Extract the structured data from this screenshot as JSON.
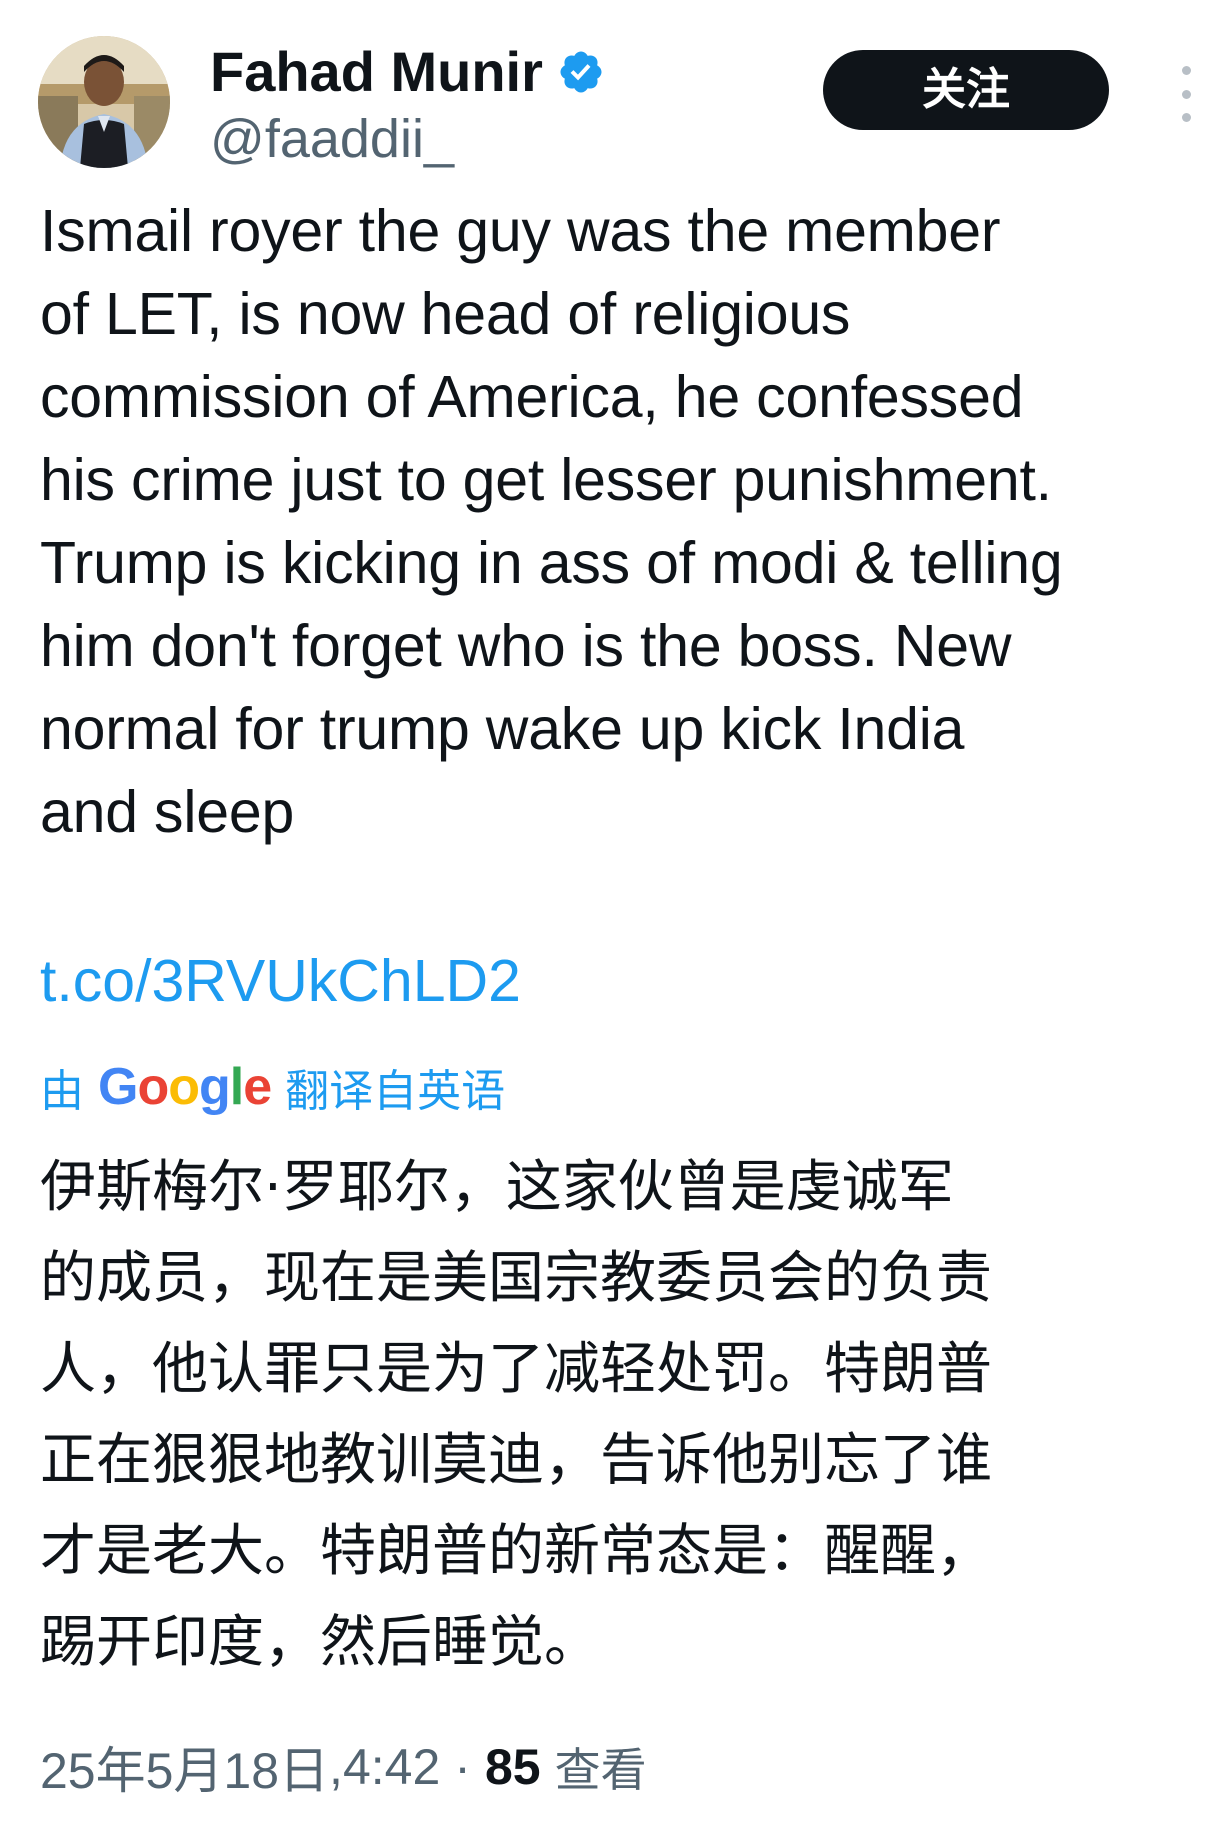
{
  "header": {
    "display_name": "Fahad Munir",
    "handle": "@faaddii_",
    "follow_label": "关注"
  },
  "icons": {
    "verified": "verified-badge-icon",
    "more": "more-vertical-icon"
  },
  "colors": {
    "link": "#1d9bf0",
    "button_bg": "#0f1419",
    "secondary_text": "#536471",
    "verified_badge": "#1d9bf0"
  },
  "tweet": {
    "text": "Ismail royer the guy was the member\nof LET, is now head of religious\ncommission of America, he confessed\nhis crime just to get lesser punishment.\nTrump is kicking in ass of modi & telling\nhim don't forget who is the boss. New\nnormal for trump wake up kick India\nand sleep",
    "link": "t.co/3RVUkChLD2"
  },
  "translation": {
    "prefix": "由",
    "provider": "Google",
    "suffix": "翻译自英语",
    "text": "伊斯梅尔·罗耶尔，这家伙曾是虔诚军\n的成员，现在是美国宗教委员会的负责\n人，他认罪只是为了减轻处罚。特朗普\n正在狠狠地教训莫迪，告诉他别忘了谁\n才是老大。特朗普的新常态是：醒醒，\n踢开印度，然后睡觉。"
  },
  "meta": {
    "date": "25年5月18日",
    "time": "4:42",
    "separator": "·",
    "views_count": "85",
    "views_label": "查看"
  }
}
